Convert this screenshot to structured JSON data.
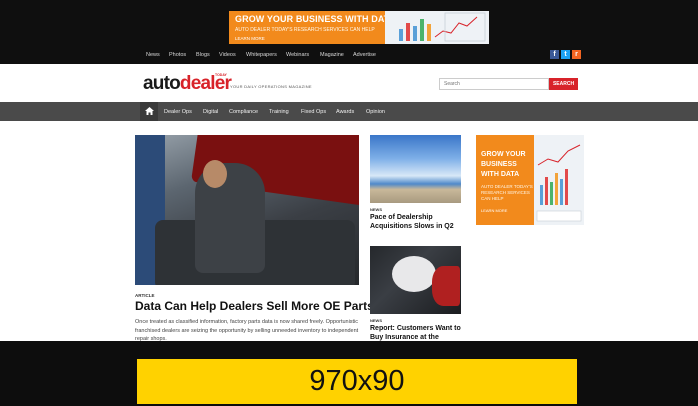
{
  "top_ad": {
    "headline": "GROW YOUR BUSINESS WITH DATA",
    "subline": "AUTO DEALER TODAY'S RESEARCH SERVICES CAN HELP",
    "cta": "LEARN MORE"
  },
  "util_nav": [
    "News",
    "Photos",
    "Blogs",
    "Videos",
    "Whitepapers",
    "Webinars",
    "Magazine",
    "Advertise"
  ],
  "social": {
    "facebook_label": "f",
    "twitter_label": "t",
    "rss_label": "r"
  },
  "logo": {
    "auto": "auto",
    "dealer": "dealer",
    "today": "TODAY",
    "tagline": "YOUR DAILY OPERATIONS MAGAZINE"
  },
  "search": {
    "placeholder": "Search",
    "button": "SEARCH"
  },
  "main_nav": [
    "Dealer Ops",
    "Digital",
    "Compliance",
    "Training",
    "Fixed Ops",
    "Awards",
    "Opinion"
  ],
  "featured": {
    "tag": "ARTICLE",
    "title": "Data Can Help Dealers Sell More OE Parts",
    "excerpt": "Once treated as classified information, factory parts data is now shared freely. Opportunistic franchised dealers are seizing the opportunity by selling unneeded inventory to independent repair shops."
  },
  "stories": [
    {
      "tag": "NEWS",
      "title": "Pace of Dealership Acquisitions Slows in Q2"
    },
    {
      "tag": "NEWS",
      "title": "Report: Customers Want to Buy Insurance at the"
    }
  ],
  "right_ad": {
    "title": "GROW YOUR BUSINESS WITH DATA",
    "subline": "AUTO DEALER TODAY'S RESEARCH SERVICES CAN HELP",
    "cta": "LEARN MORE"
  },
  "bottom_banner": {
    "label": "970x90"
  },
  "colors": {
    "accent_red": "#d8232a",
    "ad_orange": "#f28a1c",
    "banner_yellow": "#ffd200",
    "nav_gray": "#4a4a4a"
  }
}
